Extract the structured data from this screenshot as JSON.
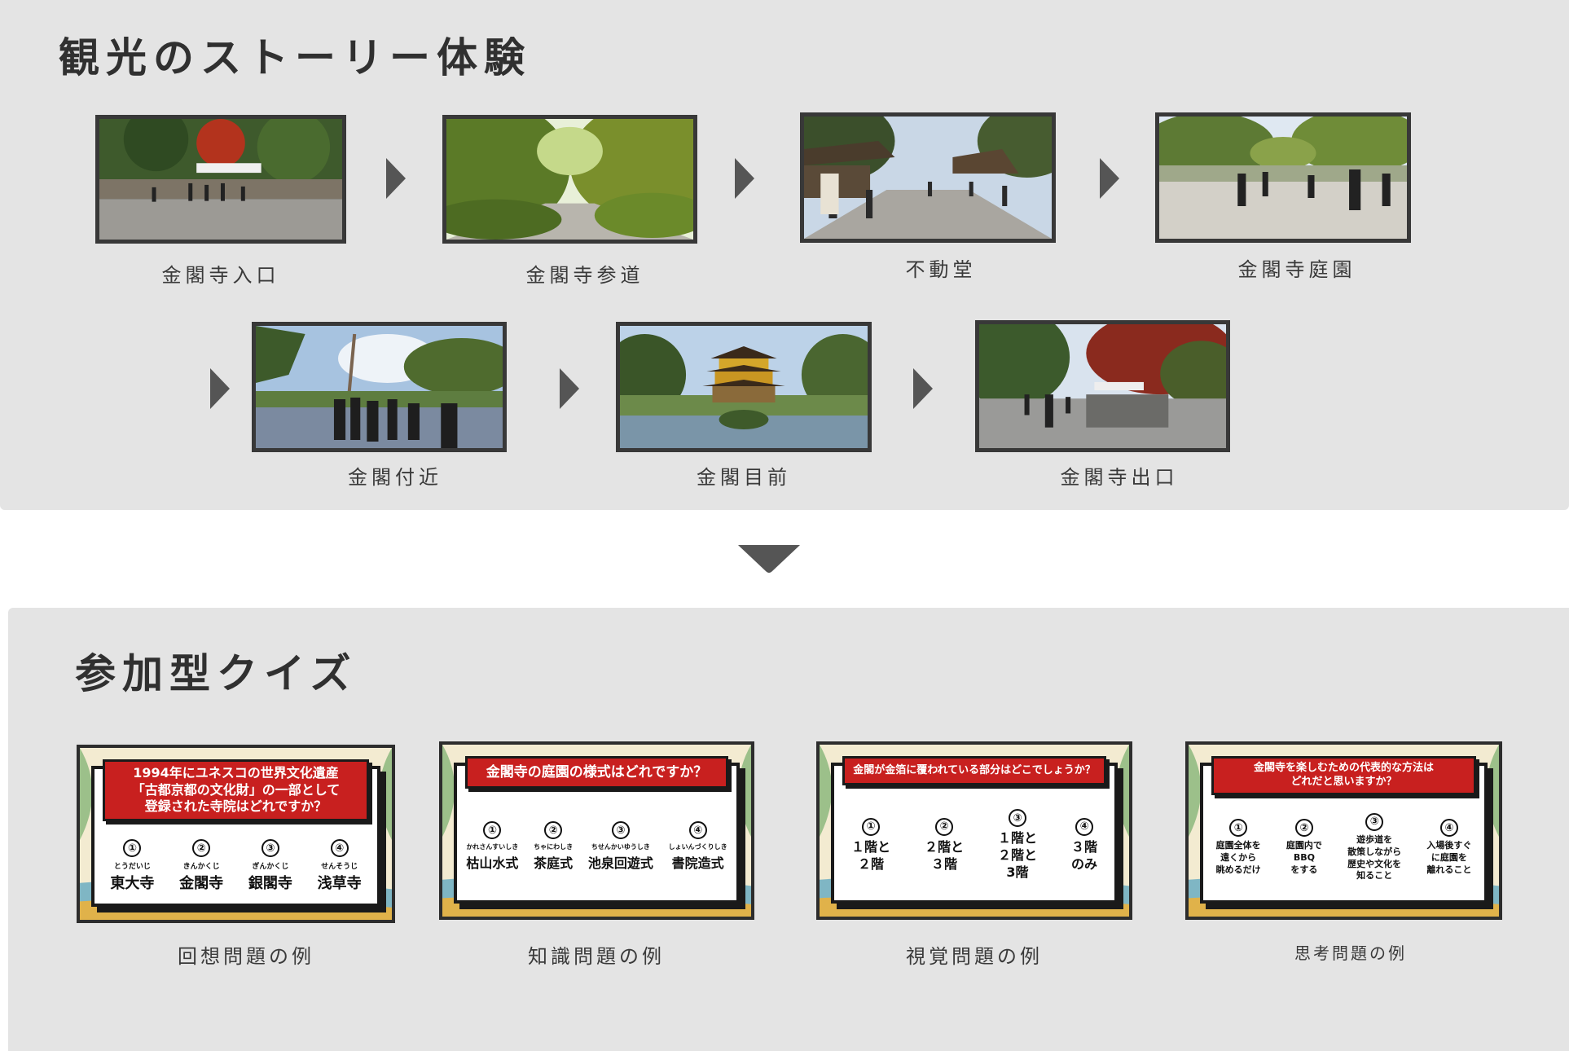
{
  "story": {
    "title": "観光のストーリー体験",
    "stops": [
      {
        "label": "金閣寺入口"
      },
      {
        "label": "金閣寺参道"
      },
      {
        "label": "不動堂"
      },
      {
        "label": "金閣寺庭園"
      },
      {
        "label": "金閣付近"
      },
      {
        "label": "金閣目前"
      },
      {
        "label": "金閣寺出口"
      }
    ]
  },
  "quiz": {
    "title": "参加型クイズ",
    "cards": [
      {
        "caption": "回想問題の例",
        "question": "1994年にユネスコの世界文化遺産\n「古都京都の文化財」の一部として\n登録された寺院はどれですか？",
        "options": [
          {
            "num": "①",
            "ruby": "とうだいじ",
            "text": "東大寺"
          },
          {
            "num": "②",
            "ruby": "きんかくじ",
            "text": "金閣寺"
          },
          {
            "num": "③",
            "ruby": "ぎんかくじ",
            "text": "銀閣寺"
          },
          {
            "num": "④",
            "ruby": "せんそうじ",
            "text": "浅草寺"
          }
        ]
      },
      {
        "caption": "知識問題の例",
        "question": "金閣寺の庭園の様式はどれですか？",
        "options": [
          {
            "num": "①",
            "ruby": "かれさんすいしき",
            "text": "枯山水式"
          },
          {
            "num": "②",
            "ruby": "ちゃにわしき",
            "text": "茶庭式"
          },
          {
            "num": "③",
            "ruby": "ちせんかいゆうしき",
            "text": "池泉回遊式"
          },
          {
            "num": "④",
            "ruby": "しょいんづくりしき",
            "text": "書院造式"
          }
        ]
      },
      {
        "caption": "視覚問題の例",
        "question": "金閣が金箔に覆われている部分はどこでしょうか？",
        "options": [
          {
            "num": "①",
            "ruby": "",
            "text": "１階と\n２階"
          },
          {
            "num": "②",
            "ruby": "",
            "text": "２階と\n３階"
          },
          {
            "num": "③",
            "ruby": "",
            "text": "１階と\n２階と\n3階"
          },
          {
            "num": "④",
            "ruby": "",
            "text": "３階\nのみ"
          }
        ]
      },
      {
        "caption": "思考問題の例",
        "question": "金閣寺を楽しむための代表的な方法は\nどれだと思いますか？",
        "options": [
          {
            "num": "①",
            "ruby": "",
            "text": "庭園全体を\n遠くから\n眺めるだけ"
          },
          {
            "num": "②",
            "ruby": "",
            "text": "庭園内で\nBBQ\nをする"
          },
          {
            "num": "③",
            "ruby": "",
            "text": "遊歩道を\n散策しながら\n歴史や文化を\n知ること"
          },
          {
            "num": "④",
            "ruby": "",
            "text": "入場後すぐ\nに庭園を\n離れること"
          }
        ]
      }
    ]
  }
}
